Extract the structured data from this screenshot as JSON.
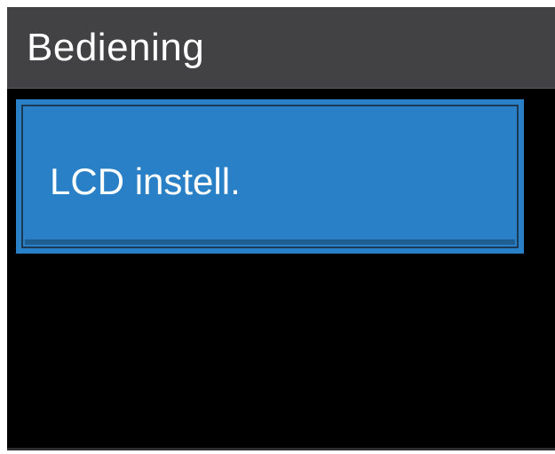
{
  "header": {
    "title": "Bediening"
  },
  "menu": {
    "items": [
      {
        "label": "LCD instell.",
        "selected": true
      }
    ]
  },
  "colors": {
    "background": "#000000",
    "header": "#424244",
    "selected_item": "#2a80c6",
    "text": "#ffffff"
  }
}
